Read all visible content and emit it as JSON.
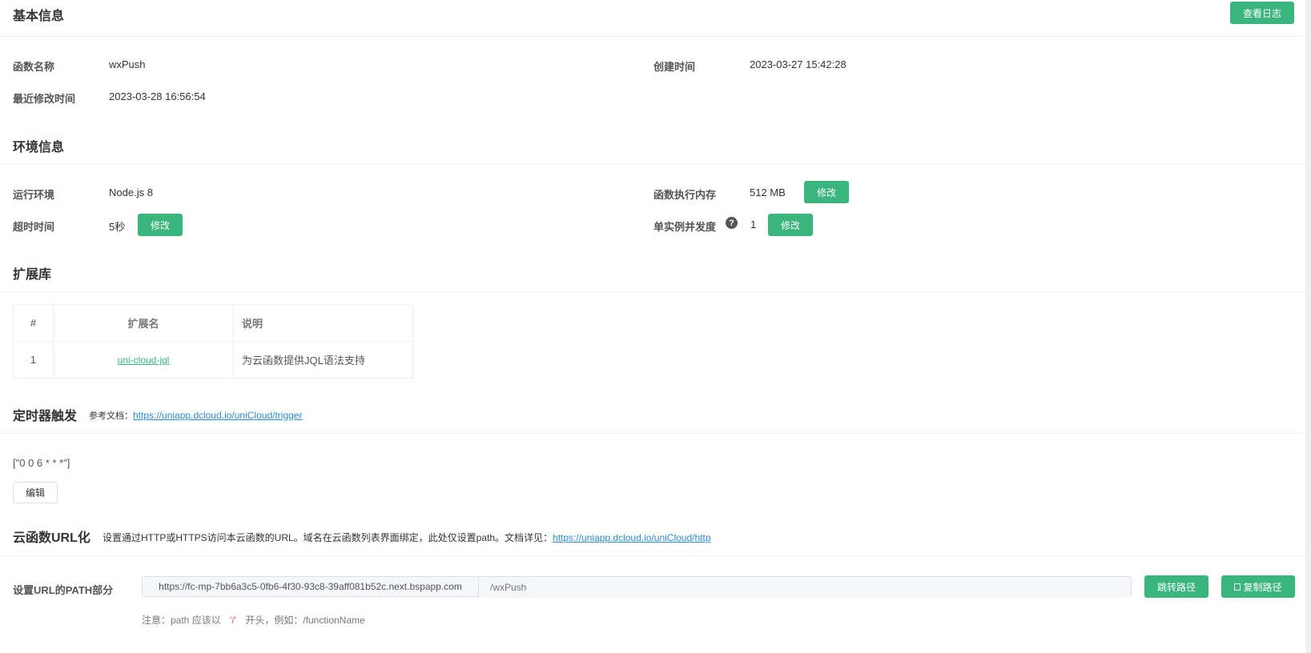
{
  "basic": {
    "title": "基本信息",
    "view_log_label": "查看日志",
    "fn_name_label": "函数名称",
    "fn_name": "wxPush",
    "created_label": "创建时间",
    "created": "2023-03-27 15:42:28",
    "modified_label": "最近修改时间",
    "modified": "2023-03-28 16:56:54"
  },
  "env": {
    "title": "环境信息",
    "runtime_label": "运行环境",
    "runtime": "Node.js 8",
    "memory_label": "函数执行内存",
    "memory": "512 MB",
    "timeout_label": "超时时间",
    "timeout": "5秒",
    "concurrency_label": "单实例并发度",
    "concurrency": "1",
    "edit_label": "修改",
    "help_icon": "?"
  },
  "ext": {
    "title": "扩展库",
    "headers": [
      "#",
      "扩展名",
      "说明"
    ],
    "rows": [
      {
        "index": "1",
        "name": "uni-cloud-jql",
        "desc": "为云函数提供JQL语法支持"
      }
    ]
  },
  "timer": {
    "title": "定时器触发",
    "ref_label": "参考文档：",
    "ref_link": "https://uniapp.dcloud.io/uniCloud/trigger",
    "cron": "[\"0 0 6 * * *\"]",
    "edit_label": "编辑"
  },
  "url": {
    "title": "云函数URL化",
    "desc": "设置通过HTTP或HTTPS访问本云函数的URL。域名在云函数列表界面绑定，此处仅设置path。文档详见：",
    "doc_link": "https://uniapp.dcloud.io/uniCloud/http",
    "path_label": "设置URL的PATH部分",
    "prefix": "https://fc-mp-7bb6a3c5-0fb6-4f30-93c8-39aff081b52c.next.bspapp.com",
    "path_placeholder": "/wxPush",
    "jump_label": "跳转路径",
    "copy_label": "复制路径",
    "note_prefix": "注意：path 应该以",
    "note_slash": "'/'",
    "note_suffix": "开头，例如：/functionName"
  },
  "colors": {
    "accent": "#3bb57e",
    "link": "#2a8bd6"
  }
}
